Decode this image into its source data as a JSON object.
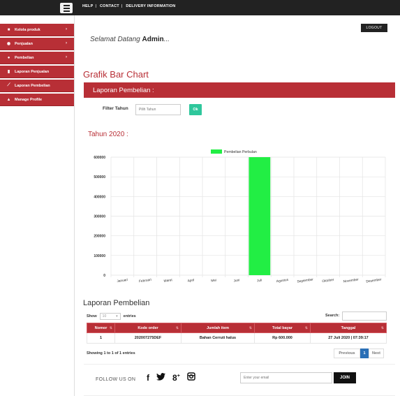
{
  "topbar": {
    "links": [
      "HELP",
      "CONTACT",
      "DELIVERY INFORMATION"
    ]
  },
  "sidebar": {
    "items": [
      {
        "label": "Kelola produk",
        "icon": "book-icon",
        "has_submenu": true
      },
      {
        "label": "Penjualan",
        "icon": "globe-icon",
        "has_submenu": true
      },
      {
        "label": "Pembelian",
        "icon": "users-icon",
        "has_submenu": true
      },
      {
        "label": "Laporan Penjualan",
        "icon": "bar-chart-icon",
        "has_submenu": false
      },
      {
        "label": "Laporan Pembelian",
        "icon": "line-chart-icon",
        "has_submenu": false
      },
      {
        "label": "Manage Profile",
        "icon": "user-icon",
        "has_submenu": false
      }
    ]
  },
  "header": {
    "logout_label": "LOGOUT",
    "welcome_prefix": "Selamat Datang ",
    "welcome_user": "Admin",
    "welcome_suffix": "..."
  },
  "main": {
    "section_title": "Grafik Bar Chart",
    "panel_title": "Laporan Pembelian :",
    "filter_label": "Filter Tahun",
    "filter_placeholder": "Pilih Tahun",
    "filter_button": "Ok",
    "year_title": "Tahun 2020 :"
  },
  "chart_data": {
    "type": "bar",
    "categories": [
      "Januari",
      "Februari",
      "Maret",
      "April",
      "Mei",
      "Juni",
      "Juli",
      "Agustus",
      "September",
      "Oktober",
      "November",
      "Desember"
    ],
    "series": [
      {
        "name": "Pembelian Perbulan",
        "values": [
          0,
          0,
          0,
          0,
          0,
          0,
          600000,
          0,
          0,
          0,
          0,
          0
        ],
        "color": "#22ee44"
      }
    ],
    "yticks": [
      "0",
      "100000",
      "200000",
      "300000",
      "400000",
      "500000",
      "600000"
    ],
    "ylim": [
      0,
      600000
    ],
    "grid": true,
    "legend_position": "top"
  },
  "table": {
    "title": "Laporan Pembelian",
    "show_label": "Show",
    "show_value": "10",
    "entries_label": "entries",
    "search_label": "Search:",
    "columns": [
      "Nomor",
      "Kode order",
      "Jumlah item",
      "Total bayar",
      "Tanggal"
    ],
    "rows": [
      [
        "1",
        "202007275DEF",
        "Bahan Cerruti halus",
        "Rp 600.000",
        "27 Juli 2020 | 07:39:17"
      ]
    ],
    "info": "Showing 1 to 1 of 1 entries",
    "prev_label": "Previous",
    "page": "1",
    "next_label": "Next"
  },
  "footer": {
    "follow_label": "FOLLOW US ON",
    "social_icons": [
      "facebook-icon",
      "twitter-icon",
      "google-plus-icon",
      "instagram-icon"
    ],
    "email_placeholder": "Enter your email",
    "join_label": "JOIN"
  }
}
